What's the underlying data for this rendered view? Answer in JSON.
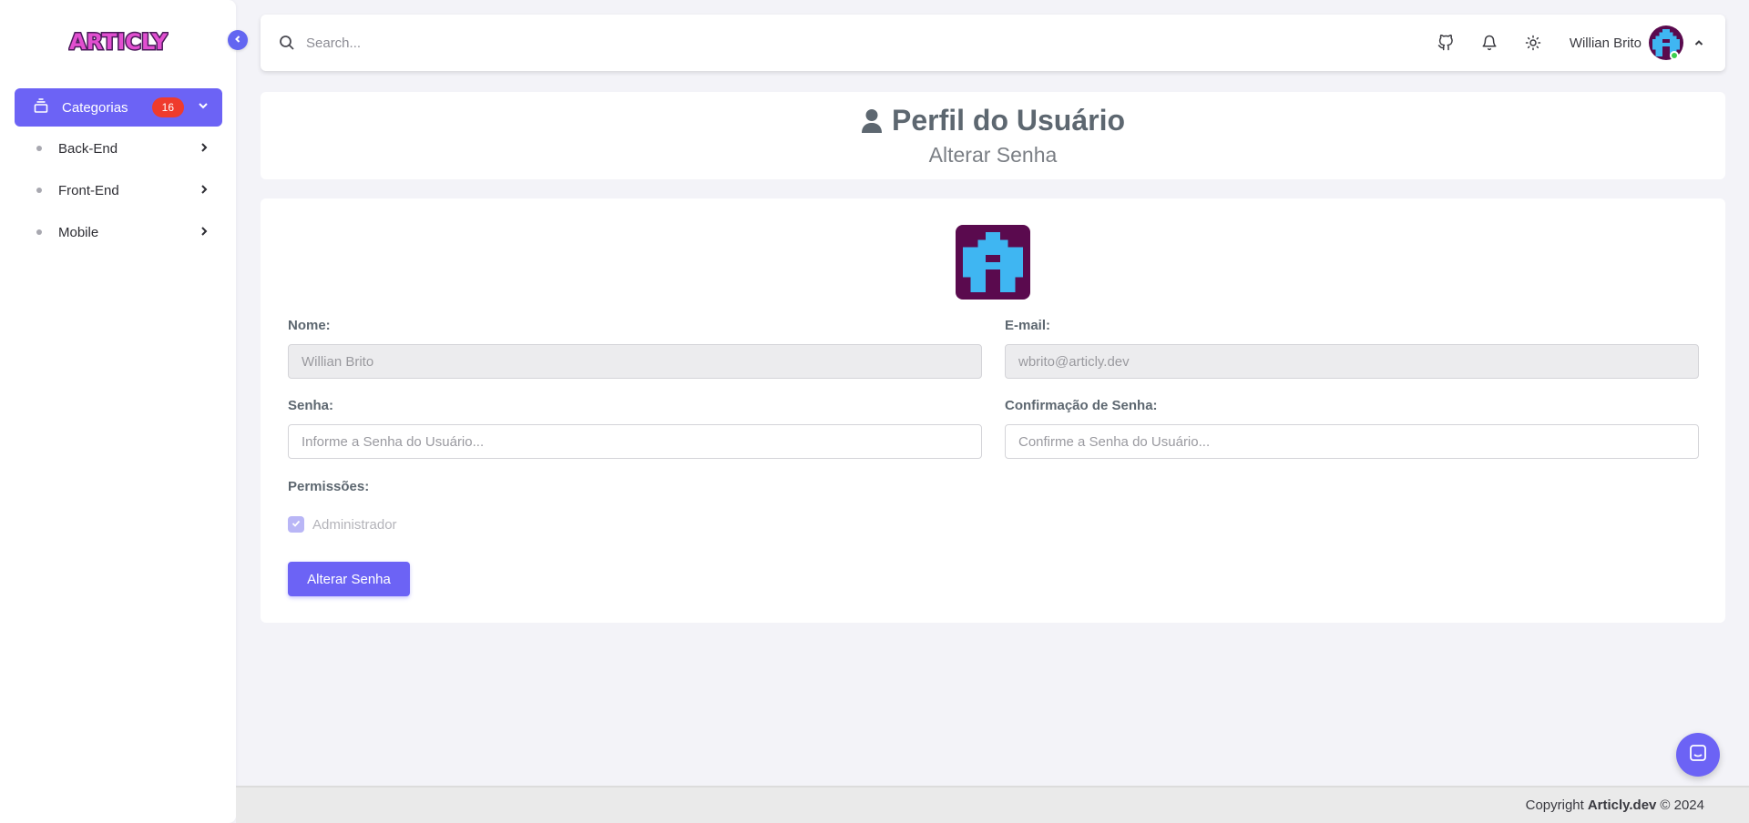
{
  "brand": {
    "logo_text": "ARTICLY"
  },
  "sidebar": {
    "active_item": {
      "label": "Categorias",
      "badge": "16"
    },
    "items": [
      {
        "label": "Back-End"
      },
      {
        "label": "Front-End"
      },
      {
        "label": "Mobile"
      }
    ]
  },
  "topbar": {
    "search_placeholder": "Search...",
    "user_name": "Willian Brito",
    "icons": [
      "github-icon",
      "bell-icon",
      "sun-icon",
      "chevron-up-icon"
    ]
  },
  "header": {
    "title": "Perfil do Usuário",
    "subtitle": "Alterar Senha"
  },
  "form": {
    "name_label": "Nome:",
    "name_value": "Willian Brito",
    "email_label": "E-mail:",
    "email_value": "wbrito@articly.dev",
    "password_label": "Senha:",
    "password_placeholder": "Informe a Senha do Usuário...",
    "confirm_label": "Confirmação de Senha:",
    "confirm_placeholder": "Confirme a Senha do Usuário...",
    "permissions_label": "Permissões:",
    "admin_label": "Administrador",
    "submit_label": "Alterar Senha"
  },
  "footer": {
    "prefix": "Copyright",
    "brand": "Articly.dev",
    "suffix": "© 2024"
  },
  "colors": {
    "accent": "#6c63f5",
    "badge": "#ef3b2d",
    "avatar_bg": "#5a0a4e",
    "avatar_fg": "#3fb6f2"
  }
}
